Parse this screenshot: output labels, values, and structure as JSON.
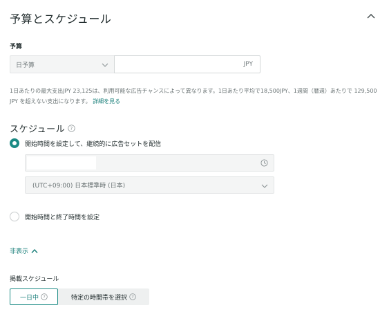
{
  "section": {
    "title": "予算とスケジュール",
    "collapse_icon": "chevron-up-icon"
  },
  "budget": {
    "label": "予算",
    "type_selected": "日予算",
    "amount_value": "",
    "currency": "JPY",
    "note": "1日あたりの最大支出JPY 23,125は、利用可能な広告チャンスによって異なります。1日あたり平均で18,500JPY、1週間（暦週）あたりで 129,500 JPY を超えない支出になります。",
    "learn_more": "詳細を見る"
  },
  "schedule": {
    "title": "スケジュール",
    "option_continuous": "開始時間を設定して、継続的に広告セットを配信",
    "start_datetime_value": "",
    "timezone": "(UTC+09:00) 日本標準時 (日本)",
    "option_start_end": "開始時間と終了時間を設定",
    "selected_option": "continuous"
  },
  "advanced": {
    "toggle_label": "非表示"
  },
  "delivery_schedule": {
    "label": "掲載スケジュール",
    "options": [
      "一日中",
      "特定の時間帯を選択"
    ],
    "selected": "一日中"
  },
  "colors": {
    "accent": "#1a8a84",
    "link": "#1a7f7a",
    "field_bg": "#f4f5f5"
  }
}
